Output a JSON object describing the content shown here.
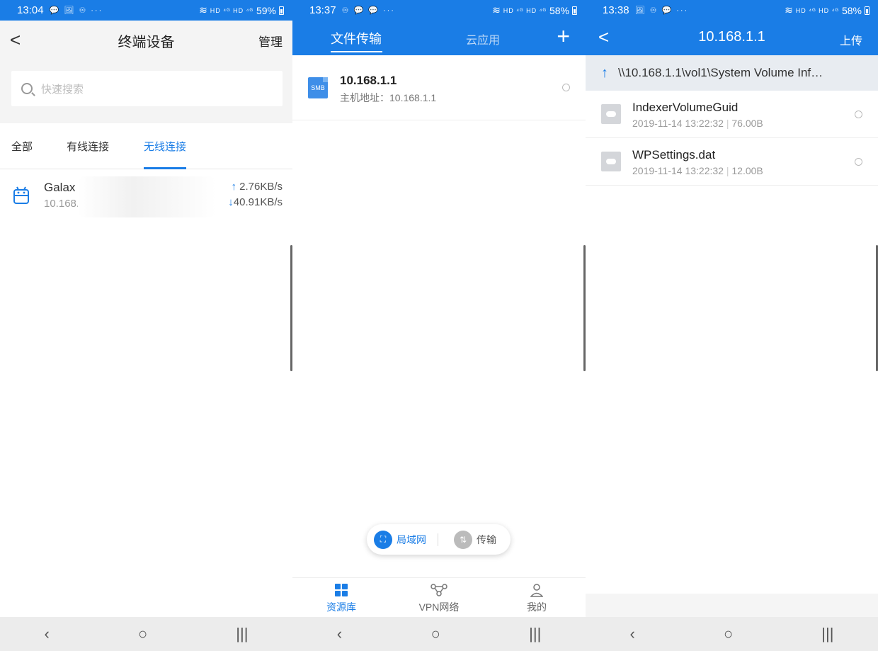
{
  "panel1": {
    "status": {
      "time": "13:04",
      "left_icons": "💬 🖼 ♾ ···",
      "battery": "59%"
    },
    "header": {
      "title": "终端设备",
      "manage": "管理",
      "back": "<"
    },
    "search": {
      "placeholder": "快速搜索"
    },
    "tabs": [
      "全部",
      "有线连接",
      "无线连接"
    ],
    "active_tab": "无线连接",
    "device": {
      "name": "Galax",
      "ip": "10.168.",
      "upload_speed": "2.76KB/s",
      "download_speed": "40.91KB/s"
    }
  },
  "panel2": {
    "status": {
      "time": "13:37",
      "left_icons": "♾ 💬 💬 ···",
      "battery": "58%"
    },
    "tabs": {
      "active": "文件传输",
      "inactive": "云应用"
    },
    "plus": "+",
    "server": {
      "icon_label": "SMB",
      "name": "10.168.1.1",
      "address": "主机地址：10.168.1.1"
    },
    "pill": {
      "lan": "局域网",
      "transfer": "传输"
    },
    "tabbar": [
      "资源库",
      "VPN网络",
      "我的"
    ]
  },
  "panel3": {
    "status": {
      "time": "13:38",
      "left_icons": "🖼 ♾ 💬 ···",
      "battery": "58%"
    },
    "header": {
      "title": "10.168.1.1",
      "upload": "上传",
      "back": "<"
    },
    "path": "\\\\10.168.1.1\\vol1\\System Volume Inf…",
    "files": [
      {
        "name": "IndexerVolumeGuid",
        "date": "2019-11-14 13:22:32",
        "size": "76.00B"
      },
      {
        "name": "WPSettings.dat",
        "date": "2019-11-14 13:22:32",
        "size": "12.00B"
      }
    ]
  },
  "status_common": {
    "signal": "HD ⁴ᴳ HD ⁴ᴳ"
  },
  "sysnav": {
    "back": "‹",
    "home": "○",
    "recents": "|||"
  },
  "colors": {
    "accent": "#1a7de6"
  }
}
